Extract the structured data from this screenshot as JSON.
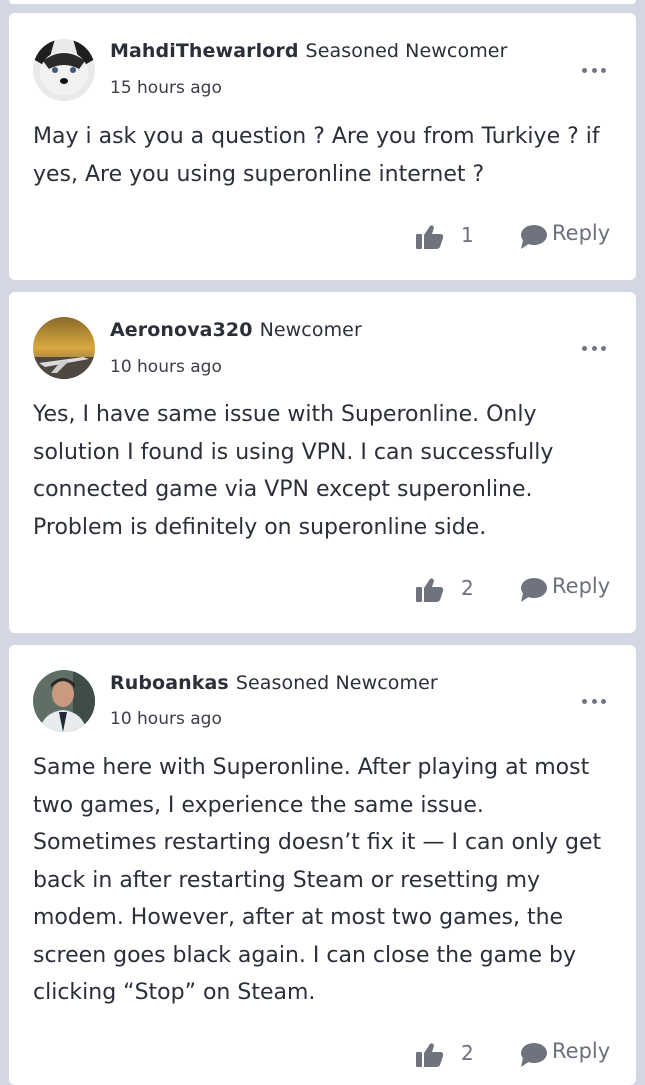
{
  "comments": [
    {
      "username": "MahdiThewarlord",
      "rank": "Seasoned Newcomer",
      "time": "15 hours ago",
      "avatar_icon": "husky-avatar",
      "text": "May i ask you a question ? Are you from Turkiye ? if yes, Are you using superonline internet ?",
      "likes": "1",
      "reply_label": "Reply"
    },
    {
      "username": "Aeronova320",
      "rank": "Newcomer",
      "time": "10 hours ago",
      "avatar_icon": "airplane-sunset-avatar",
      "text": "Yes, I have same issue with Superonline. Only solution I found is using VPN. I can successfully connected game via VPN except superonline. Problem is definitely on superonline side.",
      "likes": "2",
      "reply_label": "Reply"
    },
    {
      "username": "Ruboankas",
      "rank": "Seasoned Newcomer",
      "time": "10 hours ago",
      "avatar_icon": "person-avatar",
      "text": "Same here with Superonline. After playing at most two games, I experience the same issue. Sometimes restarting doesn’t fix it — I can only get back in after restarting Steam or resetting my modem. However, after at most two games, the screen goes black again. I can close the game by clicking “Stop” on Steam.",
      "likes": "2",
      "reply_label": "Reply"
    }
  ],
  "colors": {
    "background": "#d3d7e3",
    "card": "#ffffff",
    "text": "#2b2f3a",
    "muted": "#6b707c"
  }
}
